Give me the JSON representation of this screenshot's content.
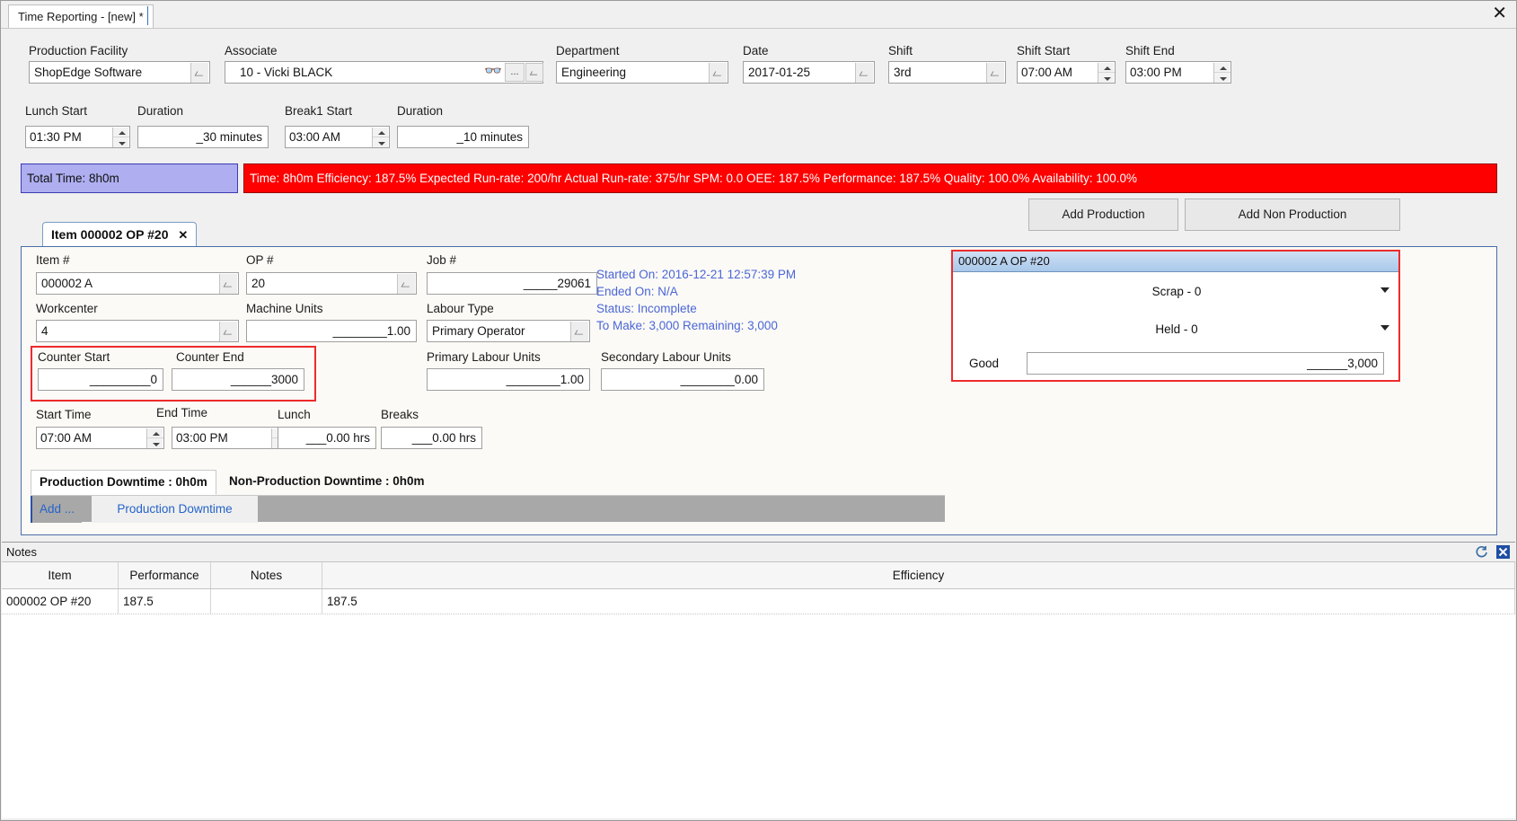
{
  "window": {
    "tab_title": "Time Reporting - [new] *",
    "close_icon": "close-icon"
  },
  "header": {
    "production_facility": {
      "label": "Production Facility",
      "value": "ShopEdge Software"
    },
    "associate": {
      "label": "Associate",
      "value": "10 - Vicki BLACK",
      "find_icon": "binoculars-icon",
      "ellipsis_label": "..."
    },
    "department": {
      "label": "Department",
      "value": "Engineering"
    },
    "date": {
      "label": "Date",
      "value": "2017-01-25"
    },
    "shift": {
      "label": "Shift",
      "value": "3rd"
    },
    "shift_start": {
      "label": "Shift Start",
      "value": "07:00 AM"
    },
    "shift_end": {
      "label": "Shift End",
      "value": "03:00 PM"
    },
    "lunch_start": {
      "label": "Lunch Start",
      "value": "01:30 PM"
    },
    "lunch_duration": {
      "label": "Duration",
      "value": "_30 minutes"
    },
    "break1_start": {
      "label": "Break1 Start",
      "value": "03:00 AM"
    },
    "break1_duration": {
      "label": "Duration",
      "value": "_10 minutes"
    }
  },
  "status": {
    "total_time": "Total Time: 8h0m",
    "metrics": "Time: 8h0m  Efficiency: 187.5%  Expected Run-rate: 200/hr  Actual Run-rate: 375/hr  SPM: 0.0  OEE: 187.5%  Performance: 187.5%  Quality: 100.0%  Availability: 100.0%",
    "total_time_bg": "#aeaef0",
    "metrics_bg": "#fe0000"
  },
  "actions": {
    "add_production": "Add Production",
    "add_non_production": "Add Non Production"
  },
  "item_tab": {
    "label": "Item 000002 OP #20",
    "close_glyph": "✕"
  },
  "item_form": {
    "item_no": {
      "label": "Item #",
      "value": "000002 A"
    },
    "op_no": {
      "label": "OP #",
      "value": "20"
    },
    "job_no": {
      "label": "Job #",
      "value": "_____29061"
    },
    "workcenter": {
      "label": "Workcenter",
      "value": "4"
    },
    "machine_units": {
      "label": "Machine Units",
      "value": "________1.00"
    },
    "labour_type": {
      "label": "Labour Type",
      "value": "Primary Operator"
    },
    "counter_start": {
      "label": "Counter Start",
      "value": "_________0"
    },
    "counter_end": {
      "label": "Counter End",
      "value": "______3000"
    },
    "primary_labour_units": {
      "label": "Primary Labour Units",
      "value": "________1.00"
    },
    "secondary_labour_units": {
      "label": "Secondary Labour Units",
      "value": "________0.00"
    },
    "start_time": {
      "label": "Start Time",
      "value": "07:00 AM"
    },
    "end_time": {
      "label": "End Time",
      "value": "03:00 PM"
    },
    "lunch": {
      "label": "Lunch",
      "value": "___0.00 hrs"
    },
    "breaks": {
      "label": "Breaks",
      "value": "___0.00 hrs"
    }
  },
  "job_info": {
    "started_on": "Started On: 2016-12-21 12:57:39 PM",
    "ended_on": "Ended On: N/A",
    "status": "Status: Incomplete",
    "to_make_remaining": "To Make: 3,000   Remaining: 3,000",
    "color": "#4b66d8"
  },
  "production_card": {
    "header": "000002 A OP #20",
    "scrap": "Scrap - 0",
    "held": "Held - 0",
    "good_label": "Good",
    "good_value": "______3,000",
    "border_color": "#ee2b2b"
  },
  "downtime": {
    "tab_production": "Production Downtime : 0h0m",
    "tab_non_production": "Non-Production Downtime : 0h0m",
    "add_label": "Add ...",
    "crumb_label": "Production Downtime"
  },
  "notes": {
    "title": "Notes",
    "refresh_icon": "refresh-icon",
    "close_icon": "close-panel-icon",
    "columns": [
      "Item",
      "Performance",
      "Notes",
      "Efficiency"
    ],
    "rows": [
      {
        "item": "000002 OP #20",
        "performance": "187.5",
        "notes": "",
        "efficiency": "187.5"
      }
    ]
  }
}
